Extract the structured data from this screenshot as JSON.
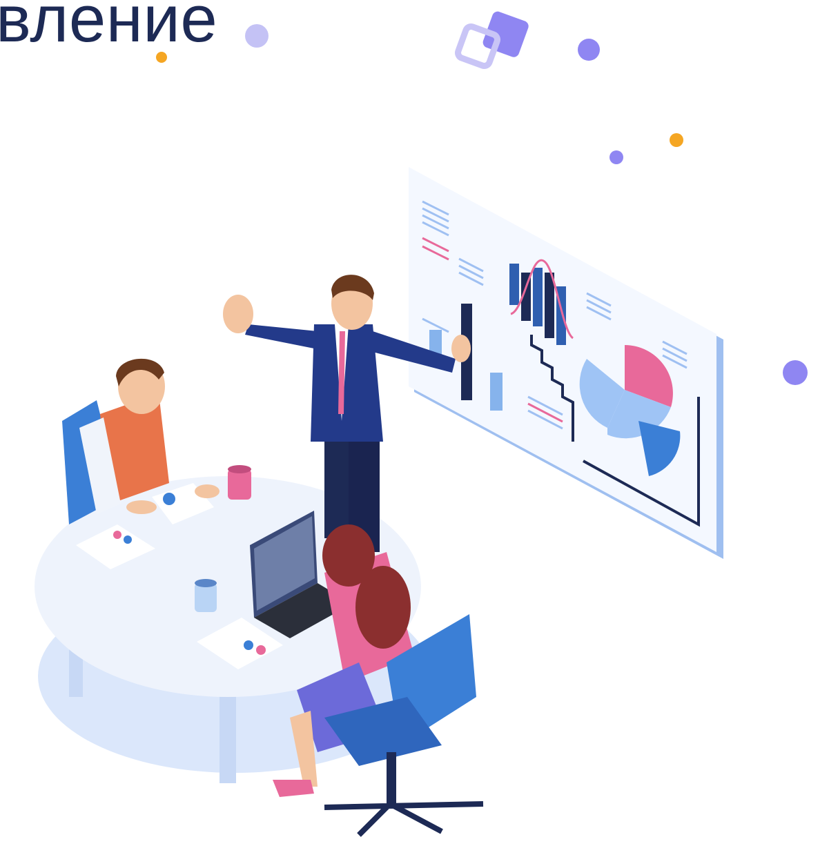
{
  "heading": {
    "text": "вление"
  },
  "illustration": {
    "scene": "business-meeting-dashboard",
    "colors": {
      "navy": "#1d2a55",
      "accent_purple": "#8f86f2",
      "accent_orange": "#f5a623",
      "pink": "#e8699a",
      "blue": "#3b7fd6",
      "light_blue": "#c9dcf7",
      "table_white": "#eef3fc"
    }
  }
}
